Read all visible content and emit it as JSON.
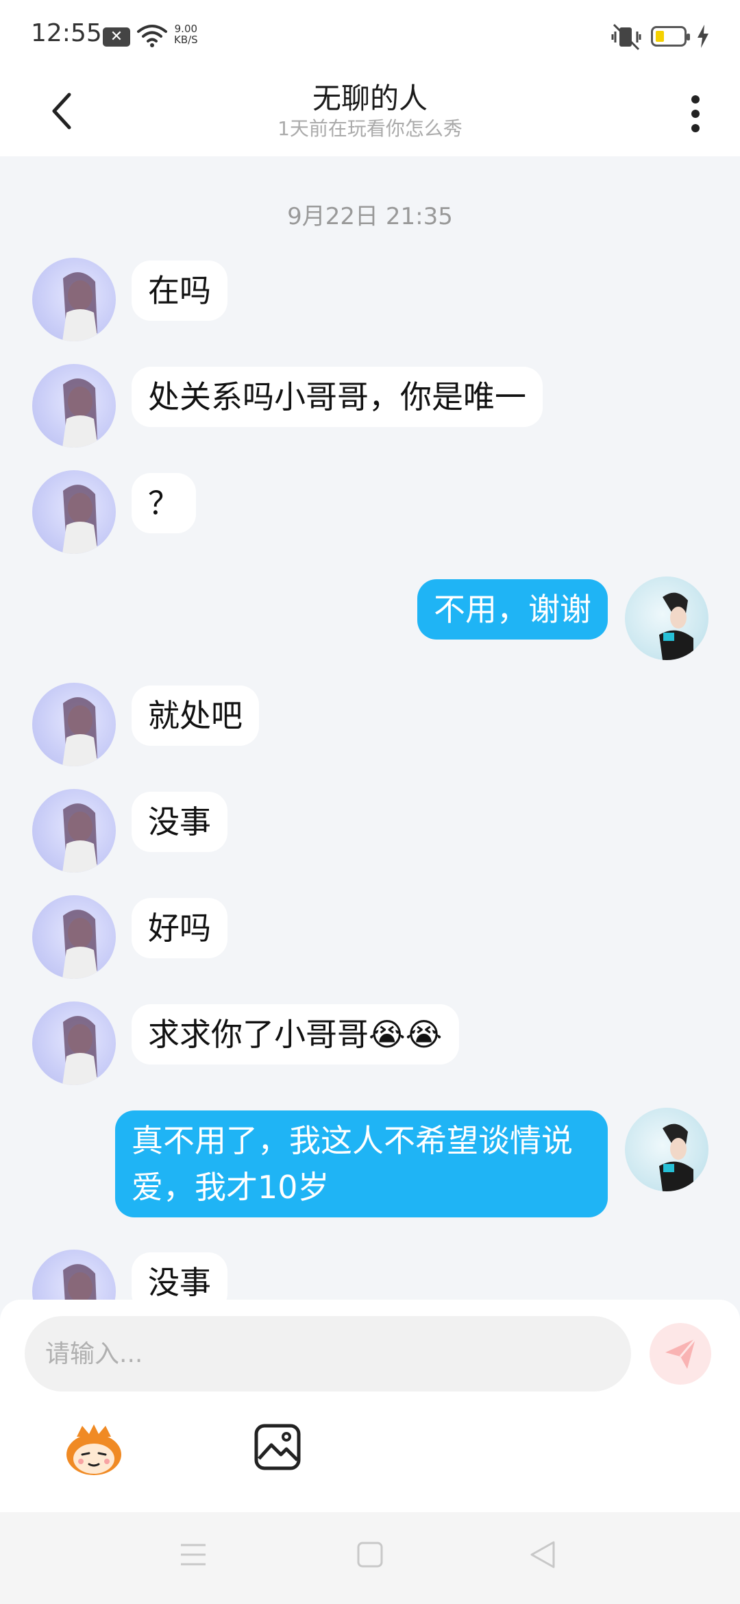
{
  "status_bar": {
    "time": "12:55",
    "notif_badge": "✕",
    "net_speed_value": "9.00",
    "net_speed_unit": "KB/S",
    "battery_level": 0.2,
    "battery_color": "#f5d100"
  },
  "header": {
    "title": "无聊的人",
    "subtitle": "1天前在玩看你怎么秀",
    "back_icon": "chevron-left-icon",
    "more_icon": "more-vertical-icon"
  },
  "chat": {
    "timestamp": "9月22日 21:35",
    "messages": [
      {
        "side": "in",
        "text": "在吗"
      },
      {
        "side": "in",
        "text": "处关系吗小哥哥，你是唯一"
      },
      {
        "side": "in",
        "text": "？"
      },
      {
        "side": "out",
        "text": "不用，谢谢"
      },
      {
        "side": "in",
        "text": "就处吧"
      },
      {
        "side": "in",
        "text": "没事"
      },
      {
        "side": "in",
        "text": "好吗"
      },
      {
        "side": "in",
        "text": "求求你了小哥哥😭😭"
      },
      {
        "side": "out",
        "text": "真不用了，我这人不希望谈情说爱，我才10岁"
      },
      {
        "side": "in",
        "text": "没事"
      }
    ]
  },
  "composer": {
    "placeholder": "请输入...",
    "send_icon": "send-icon",
    "emoji_icon": "emoji-mascot-icon",
    "image_icon": "image-icon"
  },
  "colors": {
    "accent": "#1fb4f5",
    "page_bg": "#f3f5f8",
    "send_btn": "#fde7e7"
  }
}
